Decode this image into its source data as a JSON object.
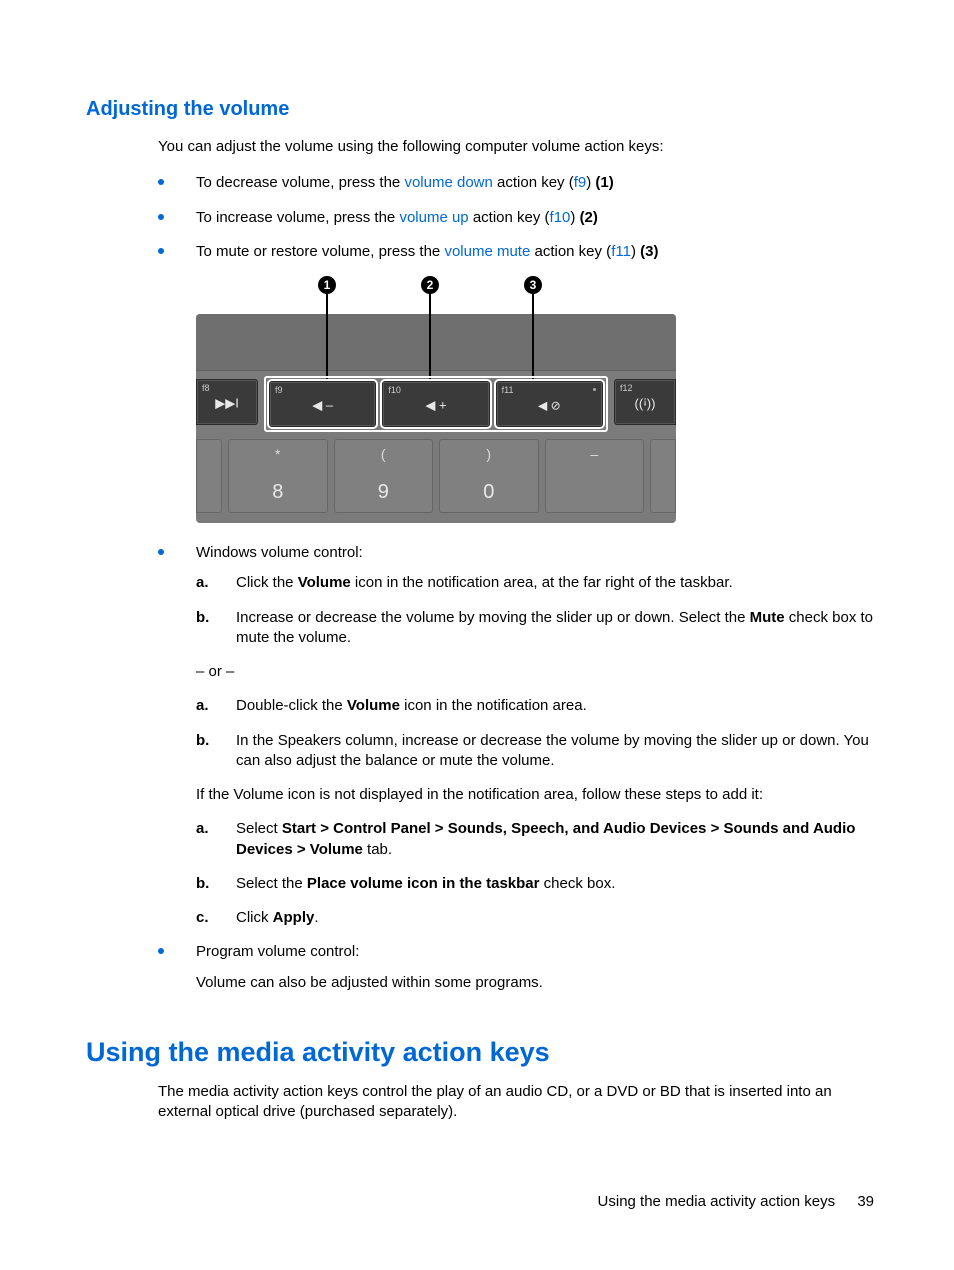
{
  "headings": {
    "h_sub": "Adjusting the volume",
    "h_main": "Using the media activity action keys"
  },
  "intro1": "You can adjust the volume using the following computer volume action keys:",
  "bullets_top": [
    {
      "pre": "To decrease volume, press the ",
      "link": "volume down",
      "mid": " action key (",
      "key": "f9",
      "post": ") ",
      "num": "(1)"
    },
    {
      "pre": "To increase volume, press the ",
      "link": "volume up",
      "mid": " action key (",
      "key": "f10",
      "post": ") ",
      "num": "(2)"
    },
    {
      "pre": "To mute or restore volume, press the ",
      "link": "volume mute",
      "mid": " action key (",
      "key": "f11",
      "post": ") ",
      "num": "(3)"
    }
  ],
  "diagram": {
    "callouts": [
      "1",
      "2",
      "3"
    ],
    "fkeys": [
      {
        "lbl": "f8",
        "glyph": "▶▶I"
      },
      {
        "lbl": "f9",
        "glyph": "◀ –"
      },
      {
        "lbl": "f10",
        "glyph": "◀ +"
      },
      {
        "lbl": "f11",
        "glyph": "◀ ⊘"
      },
      {
        "lbl": "f12",
        "glyph": "((ꜟ))"
      }
    ],
    "nkeys": [
      {
        "sym": "*",
        "num": "8"
      },
      {
        "sym": "(",
        "num": "9"
      },
      {
        "sym": ")",
        "num": "0"
      },
      {
        "sym": "–",
        "num": ""
      }
    ]
  },
  "win_vol": {
    "label": "Windows volume control:",
    "steps1": [
      {
        "m": "a.",
        "pre": "Click the ",
        "b": "Volume",
        "post": " icon in the notification area, at the far right of the taskbar."
      },
      {
        "m": "b.",
        "pre": "Increase or decrease the volume by moving the slider up or down. Select the ",
        "b": "Mute",
        "post": " check box to mute the volume."
      }
    ],
    "or": "– or –",
    "steps2": [
      {
        "m": "a.",
        "pre": "Double-click the ",
        "b": "Volume",
        "post": " icon in the notification area."
      },
      {
        "m": "b.",
        "pre": "In the Speakers column, increase or decrease the volume by moving the slider up or down. You can also adjust the balance or mute the volume.",
        "b": "",
        "post": ""
      }
    ],
    "if_not": "If the Volume icon is not displayed in the notification area, follow these steps to add it:",
    "steps3": [
      {
        "m": "a.",
        "pre": "Select ",
        "b": "Start > Control Panel > Sounds, Speech, and Audio Devices > Sounds and Audio Devices > Volume",
        "post": " tab."
      },
      {
        "m": "b.",
        "pre": "Select the ",
        "b": "Place volume icon in the taskbar",
        "post": " check box."
      },
      {
        "m": "c.",
        "pre": "Click ",
        "b": "Apply",
        "post": "."
      }
    ]
  },
  "prog_vol": {
    "label": "Program volume control:",
    "text": "Volume can also be adjusted within some programs."
  },
  "media_intro": "The media activity action keys control the play of an audio CD, or a DVD or BD that is inserted into an external optical drive (purchased separately).",
  "footer": {
    "section": "Using the media activity action keys",
    "page": "39"
  }
}
